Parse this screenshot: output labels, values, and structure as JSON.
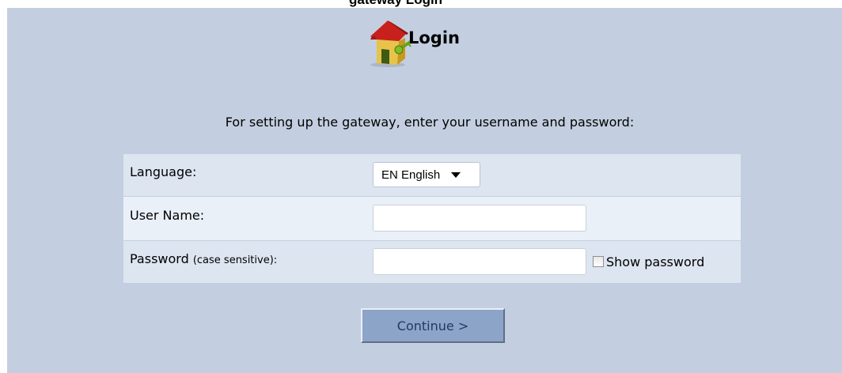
{
  "page": {
    "header_title": "Login"
  },
  "instructions": "For setting up the gateway, enter your username and password:",
  "form": {
    "language": {
      "label": "Language:",
      "selected": "EN English"
    },
    "username": {
      "label": "User Name:",
      "value": ""
    },
    "password": {
      "label": "Password",
      "label_note": "(case sensitive):",
      "value": "",
      "show_password_label": "Show password",
      "show_password_checked": false
    }
  },
  "continue_label": "Continue >",
  "icons": {
    "login": "house-key-icon",
    "select_arrow": "chevron-down-icon"
  },
  "colors": {
    "panel": "#c3cfe0",
    "row_light": "#eaf0f8",
    "row_dark": "#dde5f1",
    "button": "#8da4c9",
    "button_text": "#203a60"
  }
}
